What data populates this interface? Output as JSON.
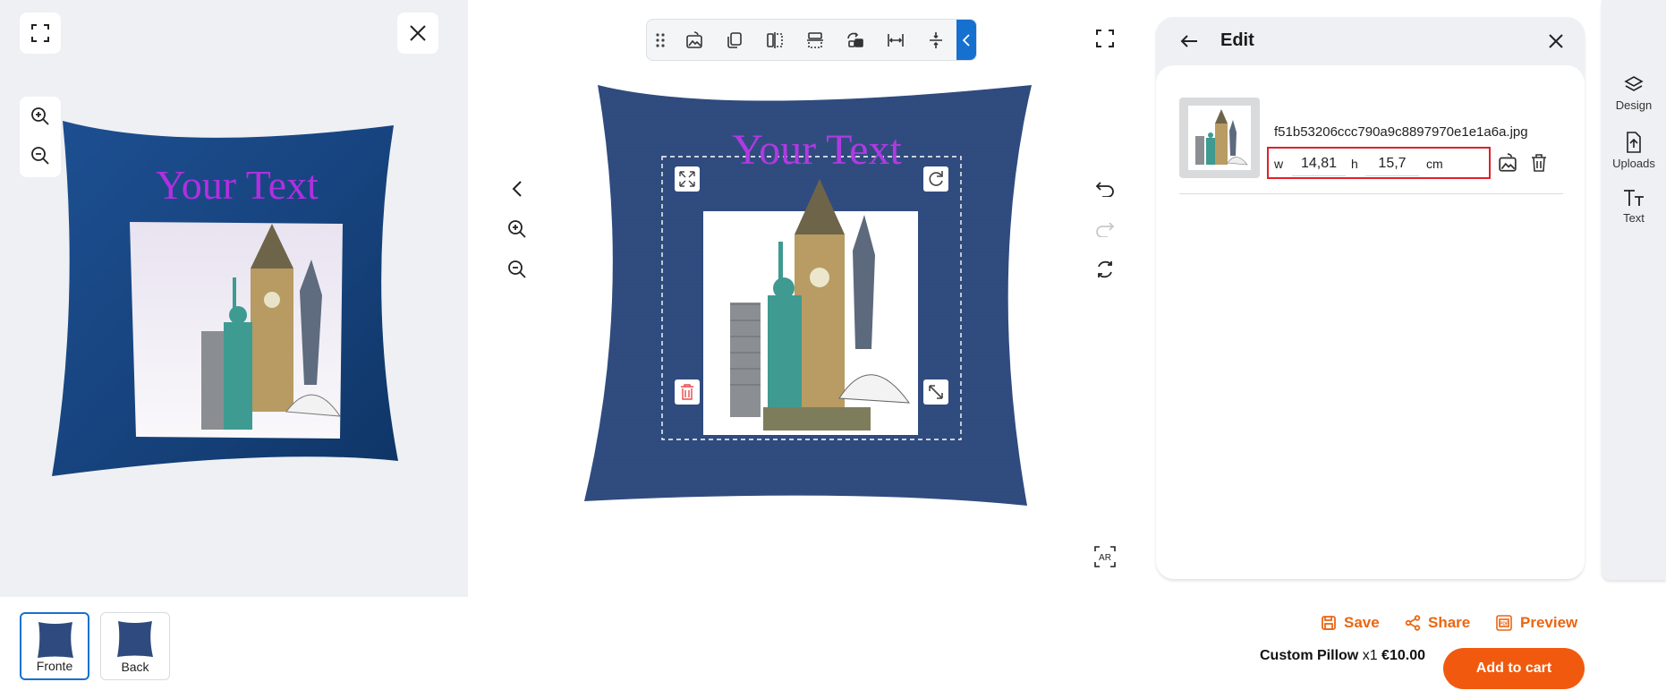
{
  "preview3d": {
    "design_text": "Your Text",
    "design_text_color": "#b12fe0"
  },
  "canvas": {
    "design_text": "Your Text",
    "design_text_color": "#b03ae2",
    "pillow_color": "#2f4a7e"
  },
  "toolbar": {
    "buttons": [
      "drag-handle-icon",
      "replace-image-icon",
      "duplicate-icon",
      "flip-horizontal-icon",
      "flip-vertical-icon",
      "layer-order-icon",
      "stretch-horizontal-icon",
      "stretch-vertical-icon"
    ],
    "accent": "#1670d0"
  },
  "edit_panel": {
    "title": "Edit",
    "filename": "f51b53206ccc790a9c8897970e1e1a6a.jpg",
    "width_label": "w",
    "width_value": "14,81",
    "height_label": "h",
    "height_value": "15,7",
    "unit": "cm"
  },
  "rail": {
    "items": [
      {
        "label": "Design",
        "icon": "layers-icon"
      },
      {
        "label": "Uploads",
        "icon": "upload-icon"
      },
      {
        "label": "Text",
        "icon": "text-icon"
      }
    ]
  },
  "sides": [
    {
      "label": "Fronte",
      "active": true
    },
    {
      "label": "Back",
      "active": false
    }
  ],
  "actions": {
    "save": "Save",
    "share": "Share",
    "preview": "Preview",
    "accent": "#ea6612"
  },
  "cart": {
    "product": "Custom Pillow",
    "qty": "x1",
    "price": "€10.00",
    "button": "Add to cart",
    "button_color": "#f15a0e"
  }
}
